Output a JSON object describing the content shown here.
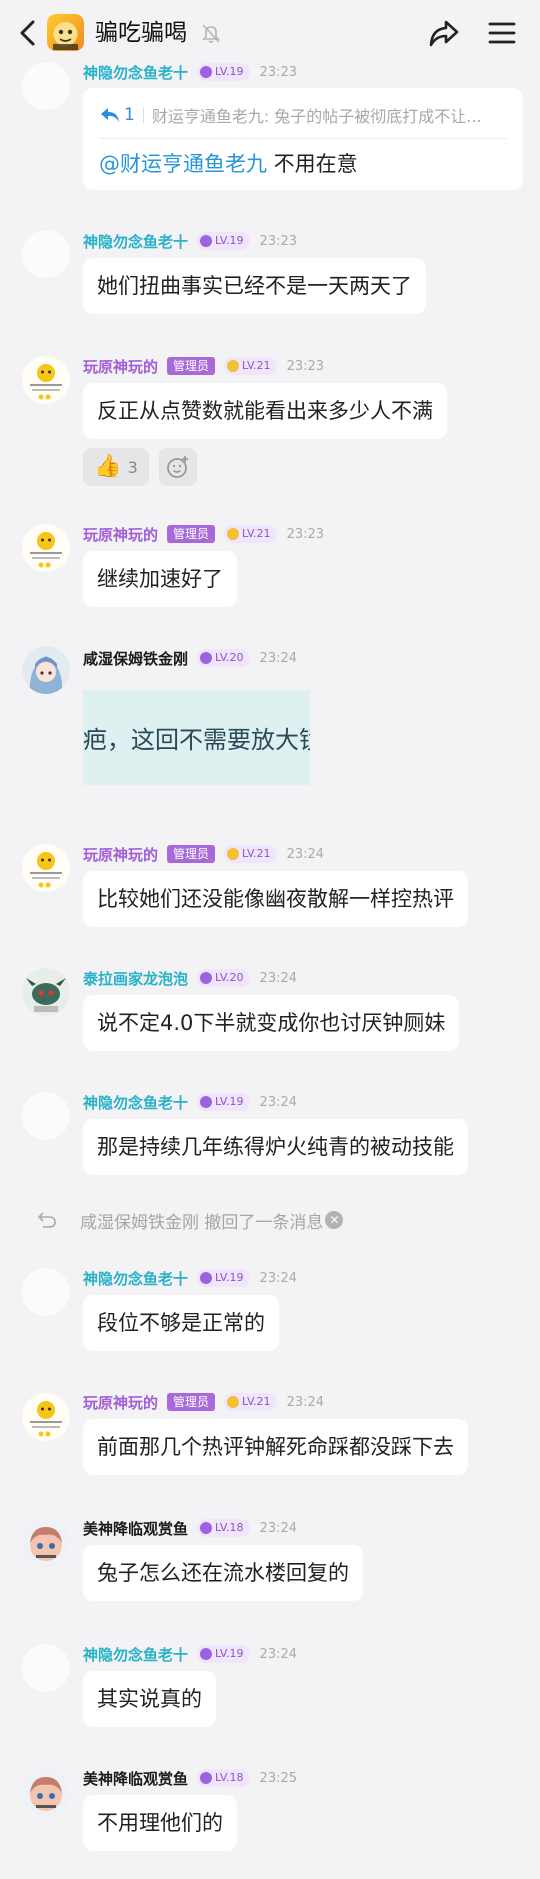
{
  "header": {
    "title": "骗吃骗喝",
    "icons": {
      "back": "back-arrow-icon",
      "mute": "mute-bell-icon",
      "share": "share-icon",
      "menu": "menu-icon"
    }
  },
  "messages": [
    {
      "user": "神隐勿念鱼老十",
      "level": "LV.19",
      "time": "23:23",
      "reply": {
        "count": "1",
        "quote": "财运亨通鱼老九: 兔子的帖子被彻底打成不让..."
      },
      "mention": "@财运亨通鱼老九",
      "text": " 不用在意"
    },
    {
      "user": "神隐勿念鱼老十",
      "level": "LV.19",
      "time": "23:23",
      "text": "她们扭曲事实已经不是一天两天了"
    },
    {
      "user": "玩原神玩的",
      "role": "管理员",
      "level": "LV.21",
      "time": "23:23",
      "text": "反正从点赞数就能看出来多少人不满",
      "reactions": {
        "like_count": "3"
      }
    },
    {
      "user": "玩原神玩的",
      "role": "管理员",
      "level": "LV.21",
      "time": "23:23",
      "text": "继续加速好了"
    },
    {
      "user": "咸湿保姆铁金刚",
      "level": "LV.20",
      "time": "23:24",
      "image_text": "疤，这回不需要放大镜"
    },
    {
      "user": "玩原神玩的",
      "role": "管理员",
      "level": "LV.21",
      "time": "23:24",
      "text": "比较她们还没能像幽夜散解一样控热评"
    },
    {
      "user": "泰拉画家龙泡泡",
      "level": "LV.20",
      "time": "23:24",
      "text": "说不定4.0下半就变成你也讨厌钟厕妹"
    },
    {
      "user": "神隐勿念鱼老十",
      "level": "LV.19",
      "time": "23:24",
      "text": "那是持续几年练得炉火纯青的被动技能"
    },
    {
      "system": "咸湿保姆铁金刚 撤回了一条消息"
    },
    {
      "user": "神隐勿念鱼老十",
      "level": "LV.19",
      "time": "23:24",
      "text": "段位不够是正常的"
    },
    {
      "user": "玩原神玩的",
      "role": "管理员",
      "level": "LV.21",
      "time": "23:24",
      "text": "前面那几个热评钟解死命踩都没踩下去"
    },
    {
      "user": "美神降临观赏鱼",
      "level": "LV.18",
      "time": "23:24",
      "text": "兔子怎么还在流水楼回复的"
    },
    {
      "user": "神隐勿念鱼老十",
      "level": "LV.19",
      "time": "23:24",
      "text": "其实说真的"
    },
    {
      "user": "美神降临观赏鱼",
      "level": "LV.18",
      "time": "23:25",
      "text": "不用理他们的"
    }
  ],
  "colors": {
    "teal_name": "#27b2c9",
    "admin_name": "#a25fd6",
    "role_badge": "#a86ad8",
    "mention": "#2a95d6",
    "background": "#f3f3f5"
  }
}
